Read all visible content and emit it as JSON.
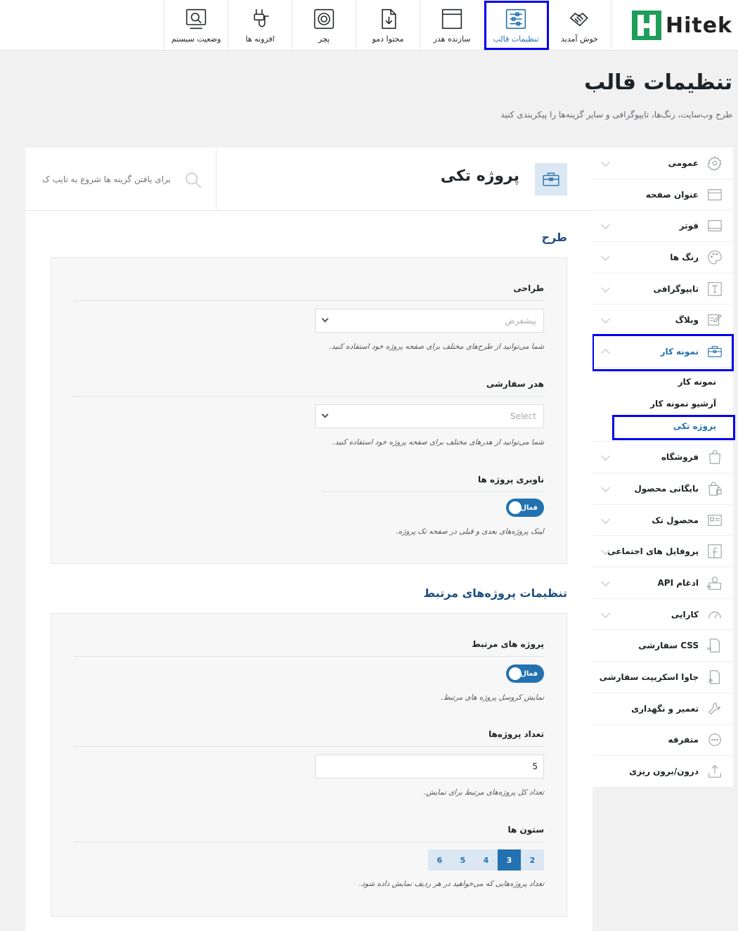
{
  "brand": {
    "name": "Hitek"
  },
  "topnav": [
    {
      "key": "welcome",
      "label": "خوش آمدید",
      "icon": "handshake-icon"
    },
    {
      "key": "theme-settings",
      "label": "تنظیمات قالب",
      "icon": "sliders-icon",
      "active": true
    },
    {
      "key": "header-builder",
      "label": "سازنده هدر",
      "icon": "window-icon"
    },
    {
      "key": "demo-content",
      "label": "محتوا دمو",
      "icon": "file-import-icon"
    },
    {
      "key": "patcher",
      "label": "پچر",
      "icon": "gear-box-icon"
    },
    {
      "key": "plugins",
      "label": "افزونه ها",
      "icon": "plug-icon"
    },
    {
      "key": "system-status",
      "label": "وضعیت سیستم",
      "icon": "system-status-icon"
    }
  ],
  "page": {
    "title": "تنظیمات قالب",
    "subtitle": "طرح وب‌سایت، رنگ‌ها، تایپوگرافی و سایر گزینه‌ها را پیکربندی کنید"
  },
  "sidebar": {
    "items": [
      {
        "key": "general",
        "label": "عمومی",
        "icon": "gear-icon",
        "chevron": true
      },
      {
        "key": "page-title",
        "label": "عنوان صفحه",
        "icon": "page-title-icon",
        "chevron": false
      },
      {
        "key": "footer",
        "label": "فوتر",
        "icon": "footer-icon",
        "chevron": true
      },
      {
        "key": "colors",
        "label": "رنگ ها",
        "icon": "palette-icon",
        "chevron": true
      },
      {
        "key": "typography",
        "label": "تایپوگرافی",
        "icon": "typography-icon",
        "chevron": true
      },
      {
        "key": "blog",
        "label": "وبلاگ",
        "icon": "edit-icon",
        "chevron": true
      },
      {
        "key": "portfolio",
        "label": "نمونه کار",
        "icon": "briefcase-icon",
        "chevron": true,
        "open": true,
        "children": [
          {
            "key": "portfolio-main",
            "label": "نمونه کار"
          },
          {
            "key": "portfolio-archive",
            "label": "آرشیو نمونه کار"
          },
          {
            "key": "single-project",
            "label": "پروژه تکی",
            "active": true
          }
        ]
      },
      {
        "key": "shop",
        "label": "فروشگاه",
        "icon": "shopping-bag-icon",
        "chevron": true
      },
      {
        "key": "product-archive",
        "label": "بایگانی محصول",
        "icon": "bag-lock-icon",
        "chevron": true
      },
      {
        "key": "single-product",
        "label": "محصول تک",
        "icon": "product-card-icon",
        "chevron": true
      },
      {
        "key": "social-profiles",
        "label": "پروفایل های اجتماعی",
        "icon": "facebook-icon",
        "chevron": true
      },
      {
        "key": "api-integrations",
        "label": "ادغام API",
        "icon": "api-icon",
        "chevron": true
      },
      {
        "key": "performance",
        "label": "کارایی",
        "icon": "speedometer-icon",
        "chevron": true
      },
      {
        "key": "custom-css",
        "label": "CSS سفارشی",
        "icon": "css-file-icon",
        "chevron": false
      },
      {
        "key": "custom-js",
        "label": "جاوا اسکریپت سفارشی",
        "icon": "js-file-icon",
        "chevron": false
      },
      {
        "key": "maintenance",
        "label": "تعمیر و نگهداری",
        "icon": "wrench-icon",
        "chevron": false
      },
      {
        "key": "misc",
        "label": "متفرقه",
        "icon": "ellipsis-circle-icon",
        "chevron": false
      },
      {
        "key": "import-export",
        "label": "درون/برون ریزی",
        "icon": "upload-icon",
        "chevron": false
      }
    ]
  },
  "main": {
    "section_title": "پروژه تکی",
    "section_icon": "briefcase-icon",
    "search_placeholder": "برای یافتن گزینه ها شروع به تایپ ک",
    "groups": {
      "layout": {
        "title": "طرح",
        "fields": {
          "design": {
            "label": "طراحی",
            "value": "پیشفرض",
            "desc": "شما می‌توانید از طرح‌های مختلف برای صفحه پروژه خود استفاده کنید."
          },
          "custom_header": {
            "label": "هدر سفارشی",
            "value": "Select",
            "desc": "شما می‌توانید از هدرهای مختلف برای صفحه پروژه خود استفاده کنید."
          },
          "project_nav": {
            "label": "ناوبری پروژه ها",
            "toggle": "فعال",
            "enabled": true,
            "desc": "لینک پروژه‌های بعدی و قبلی در صفحه تک پروژه."
          }
        }
      },
      "related": {
        "title": "تنظیمات پروژه‌های مرتبط",
        "fields": {
          "related_projects": {
            "label": "پروژه های مرتبط",
            "toggle": "فعال",
            "enabled": true,
            "desc": "نمایش کروسل پروژه های مرتبط."
          },
          "count": {
            "label": "تعداد پروژه‌ها",
            "value": "5",
            "desc": "تعداد کل پروژه‌های مرتبط برای نمایش."
          },
          "columns": {
            "label": "ستون ها",
            "options": [
              "2",
              "3",
              "4",
              "5",
              "6"
            ],
            "selected": "3",
            "desc": "تعداد پروژه‌هایی که می‌خواهید در هر ردیف نمایش داده شود."
          }
        }
      }
    }
  },
  "colors": {
    "accent": "#2271b1",
    "brand_green": "#1e9e5a",
    "highlight_border": "#0000ee"
  }
}
